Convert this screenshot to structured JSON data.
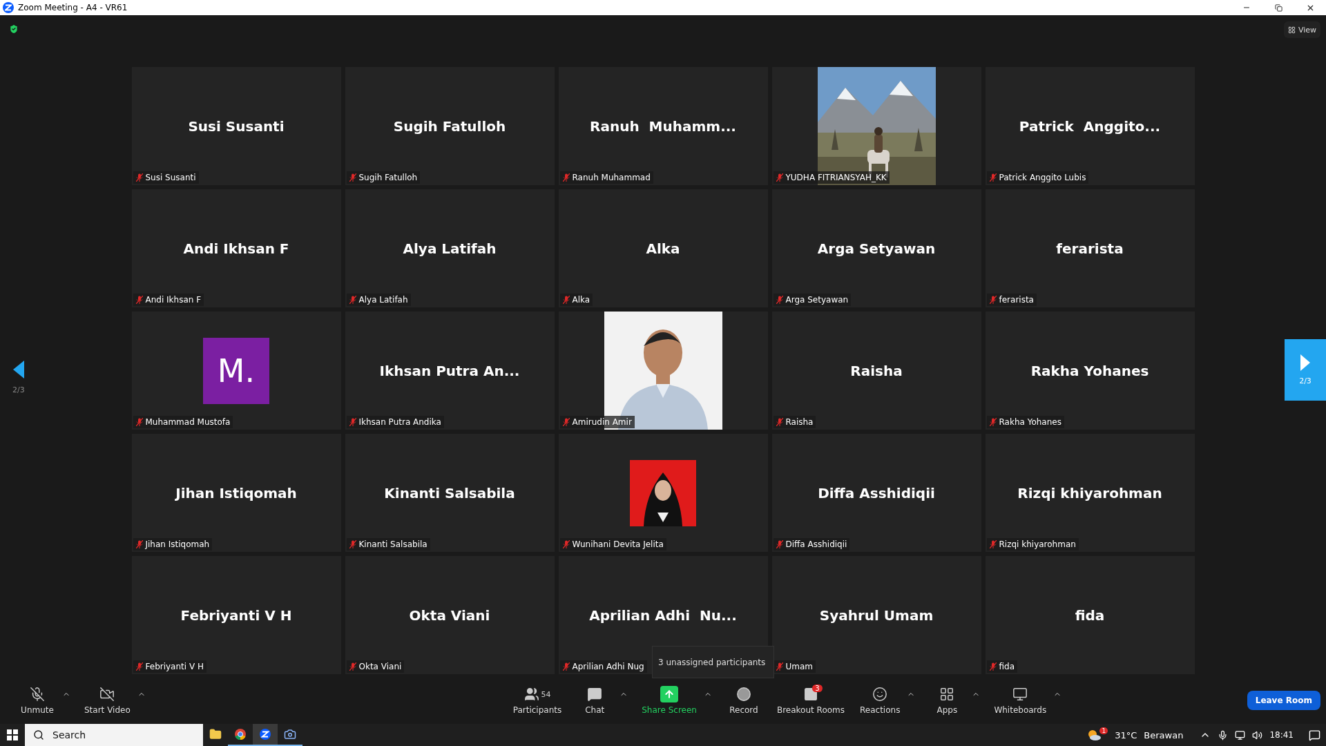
{
  "window": {
    "title": "Zoom Meeting - A4 - VR61"
  },
  "view_button": {
    "label": "View"
  },
  "pager": {
    "left_label": "2/3",
    "right_label": "2/3"
  },
  "tiles": [
    {
      "kind": "name",
      "display": "Susi Susanti",
      "label": "Susi Susanti",
      "muted": true
    },
    {
      "kind": "name",
      "display": "Sugih Fatulloh",
      "label": "Sugih Fatulloh",
      "muted": true
    },
    {
      "kind": "name",
      "display": "Ranuh  Muhamm...",
      "label": "Ranuh Muhammad",
      "muted": true
    },
    {
      "kind": "landscape_photo",
      "label": "YUDHA FITRIANSYAH_KK",
      "muted": true
    },
    {
      "kind": "name",
      "display": "Patrick  Anggito...",
      "label": "Patrick Anggito Lubis",
      "muted": true
    },
    {
      "kind": "name",
      "display": "Andi Ikhsan F",
      "label": "Andi Ikhsan F",
      "muted": true
    },
    {
      "kind": "name",
      "display": "Alya Latifah",
      "label": "Alya Latifah",
      "muted": true
    },
    {
      "kind": "name",
      "display": "Alka",
      "label": "Alka",
      "muted": true
    },
    {
      "kind": "name",
      "display": "Arga Setyawan",
      "label": "Arga Setyawan",
      "muted": true
    },
    {
      "kind": "name",
      "display": "ferarista",
      "label": "ferarista",
      "muted": true
    },
    {
      "kind": "initial",
      "display": "M.",
      "color": "#7b1fa2",
      "label": "Muhammad Mustofa",
      "muted": true
    },
    {
      "kind": "name",
      "display": "Ikhsan Putra An...",
      "label": "Ikhsan Putra Andika",
      "muted": true
    },
    {
      "kind": "portrait_photo",
      "label": "Amirudin Amir",
      "muted": true
    },
    {
      "kind": "name",
      "display": "Raisha",
      "label": "Raisha",
      "muted": true
    },
    {
      "kind": "name",
      "display": "Rakha Yohanes",
      "label": "Rakha Yohanes",
      "muted": true
    },
    {
      "kind": "name",
      "display": "Jihan Istiqomah",
      "label": "Jihan Istiqomah",
      "muted": true
    },
    {
      "kind": "name",
      "display": "Kinanti Salsabila",
      "label": "Kinanti Salsabila",
      "muted": true
    },
    {
      "kind": "small_photo",
      "label": "Wunihani Devita Jelita",
      "muted": true
    },
    {
      "kind": "name",
      "display": "Diffa Asshidiqii",
      "label": "Diffa Asshidiqii",
      "muted": true
    },
    {
      "kind": "name",
      "display": "Rizqi khiyarohman",
      "label": "Rizqi khiyarohman",
      "muted": true
    },
    {
      "kind": "name",
      "display": "Febriyanti V H",
      "label": "Febriyanti V H",
      "muted": true
    },
    {
      "kind": "name",
      "display": "Okta Viani",
      "label": "Okta Viani",
      "muted": true
    },
    {
      "kind": "name",
      "display": "Aprilian Adhi  Nu...",
      "label": "Aprilian Adhi Nug",
      "muted": true
    },
    {
      "kind": "name",
      "display": "Syahrul Umam",
      "label": "Umam",
      "muted": true
    },
    {
      "kind": "name",
      "display": "fida",
      "label": "fida",
      "muted": true
    }
  ],
  "tooltip": {
    "text": "3 unassigned participants"
  },
  "toolbar": {
    "left": [
      {
        "kind": "mic",
        "label": "Unmute",
        "has_menu": true,
        "highlighted": false
      },
      {
        "kind": "video",
        "label": "Start Video",
        "has_menu": true,
        "highlighted": false
      }
    ],
    "center": [
      {
        "kind": "participants",
        "label": "Participants",
        "count": "54",
        "has_menu": false,
        "highlighted": false
      },
      {
        "kind": "chat",
        "label": "Chat",
        "has_menu": true,
        "highlighted": false
      },
      {
        "kind": "share",
        "label": "Share Screen",
        "has_menu": true,
        "highlighted": true
      },
      {
        "kind": "record",
        "label": "Record",
        "has_menu": false,
        "highlighted": false
      },
      {
        "kind": "breakout",
        "label": "Breakout Rooms",
        "badge": "3",
        "has_menu": false,
        "highlighted": false
      },
      {
        "kind": "reactions",
        "label": "Reactions",
        "has_menu": true,
        "highlighted": false
      },
      {
        "kind": "apps",
        "label": "Apps",
        "has_menu": true,
        "highlighted": false
      },
      {
        "kind": "whiteboards",
        "label": "Whiteboards",
        "has_menu": true,
        "highlighted": false
      }
    ],
    "leave_button": "Leave Room"
  },
  "taskbar": {
    "search": {
      "placeholder": "Search"
    },
    "weather": {
      "badge": "1",
      "temperature": "31°C",
      "condition": "Berawan"
    },
    "time": "18:41"
  }
}
